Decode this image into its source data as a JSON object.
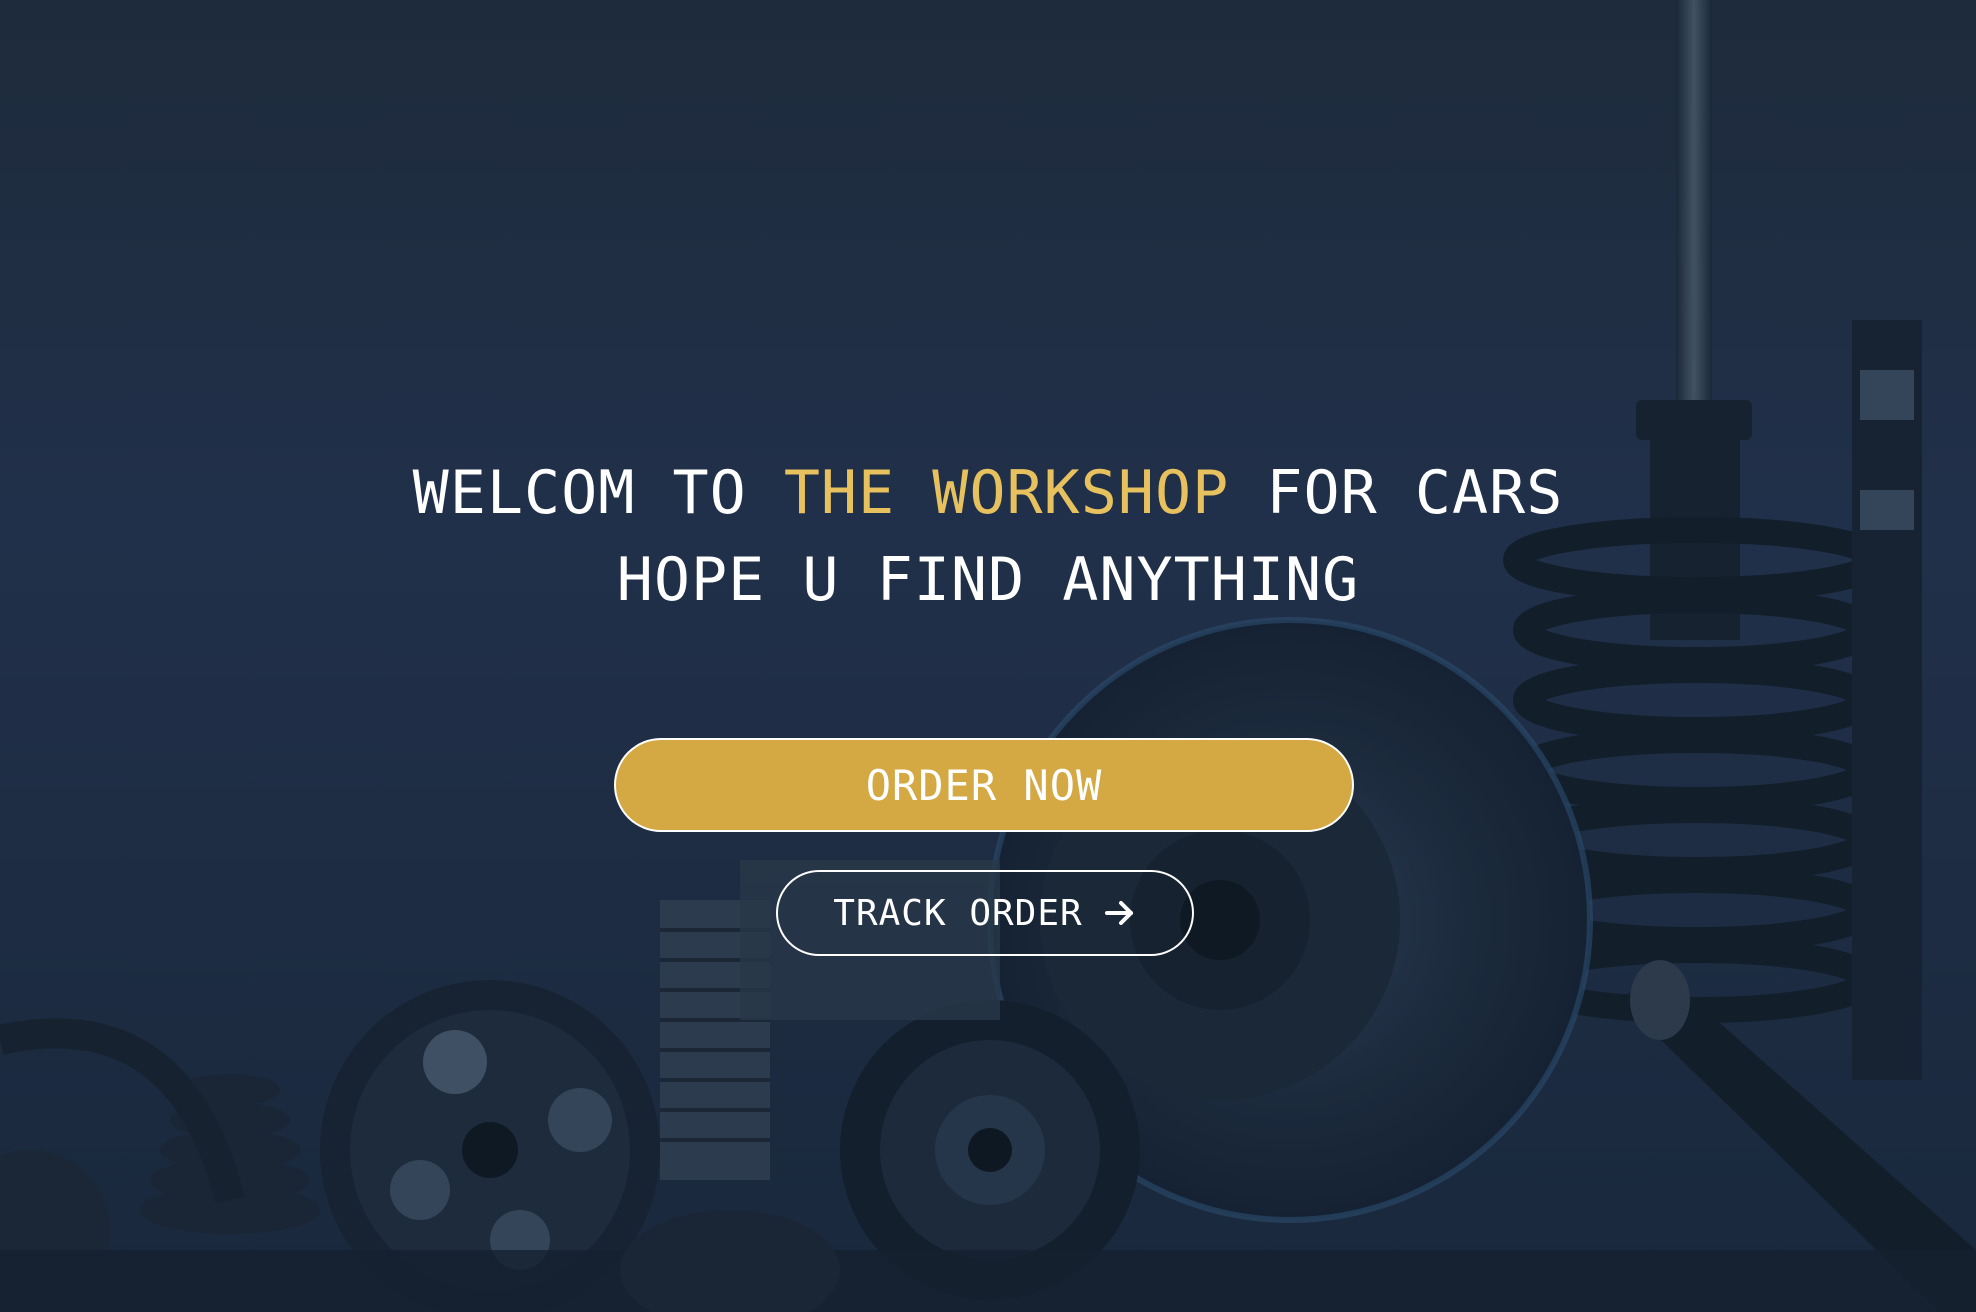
{
  "hero": {
    "line1_part1": "WELCOM TO ",
    "line1_accent": "THE WORKSHOP",
    "line1_part2": " FOR CARS",
    "line2": "HOPE U FIND ANYTHING"
  },
  "buttons": {
    "order_label": "ORDER NOW",
    "track_label": "TRACK ORDER"
  },
  "icons": {
    "track_icon": "arrow-right-icon",
    "background": "car-parts-image"
  },
  "colors": {
    "accent": "#e8c15f",
    "order_button": "#d4a843",
    "background": "#1f2d3f"
  }
}
